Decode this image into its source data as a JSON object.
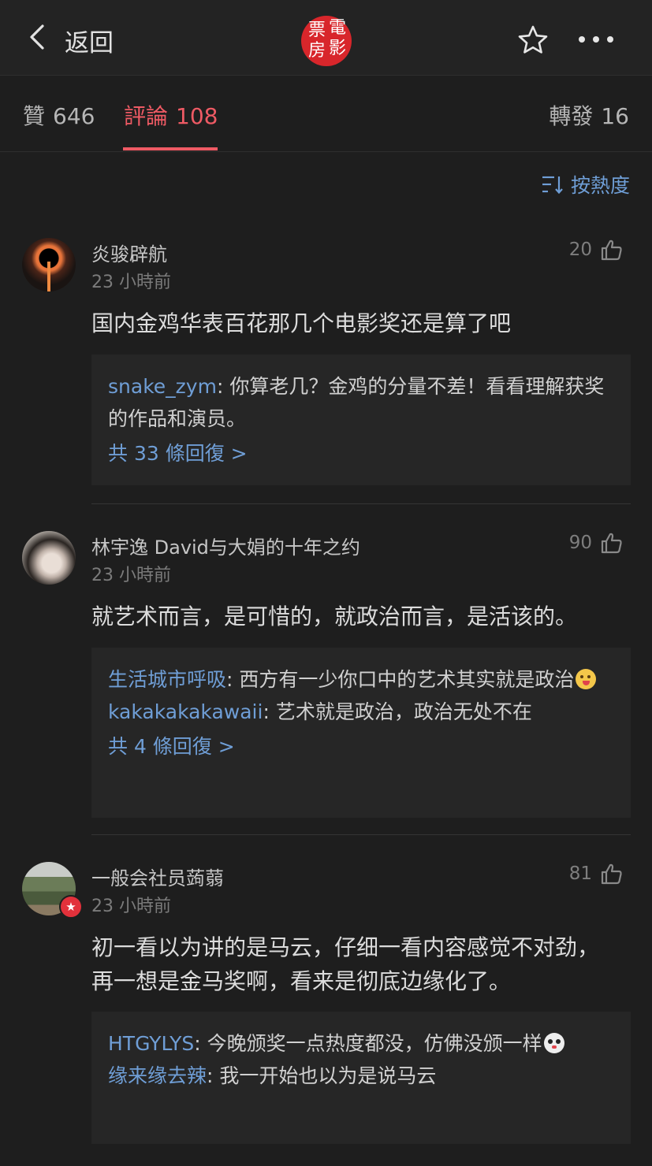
{
  "nav": {
    "back_label": "返回",
    "logo_chars": [
      "票",
      "電",
      "房",
      "影"
    ],
    "logo_color": "#d8262b"
  },
  "tabs": [
    {
      "label": "贊",
      "count": "646"
    },
    {
      "label": "評論",
      "count": "108"
    },
    {
      "label": "轉發",
      "count": "16"
    }
  ],
  "active_tab_color": "#ee5a64",
  "sort": {
    "label": "按熱度"
  },
  "comments": [
    {
      "user": "炎骏辟航",
      "time": "23 小時前",
      "likes": "20",
      "text": "国内金鸡华表百花那几个电影奖还是算了吧",
      "replies": [
        {
          "user": "snake_zym",
          "sep": ": ",
          "text": "你算老几？金鸡的分量不差！看看理解获奖的作品和演员。"
        }
      ],
      "more": "共 33 條回復 >"
    },
    {
      "user": "林宇逸 David与大娟的十年之约",
      "time": "23 小時前",
      "likes": "90",
      "text": "就艺术而言，是可惜的，就政治而言，是活该的。",
      "replies": [
        {
          "user": "生活城市呼吸",
          "sep": ": ",
          "text": "西方有一少你口中的艺术其实就是政治"
        },
        {
          "user": "kakakakakawaii",
          "sep": ": ",
          "text": "艺术就是政治，政治无处不在"
        }
      ],
      "more": "共 4 條回復 >"
    },
    {
      "user": "一般会社员蒟蒻",
      "time": "23 小時前",
      "likes": "81",
      "text": "初一看以为讲的是马云，仔细一看内容感觉不对劲，再一想是金马奖啊，看来是彻底边缘化了。",
      "replies": [
        {
          "user": "HTGYLYS",
          "sep": ": ",
          "text": "今晚颁奖一点热度都没，仿佛没颁一样"
        },
        {
          "user": "缘来缘去辣",
          "sep": ": ",
          "text": "我一开始也以为是说马云"
        }
      ]
    }
  ],
  "colors": {
    "background": "#1e1e1e",
    "reply_box": "#262626",
    "link_blue": "#6f9ed6"
  }
}
